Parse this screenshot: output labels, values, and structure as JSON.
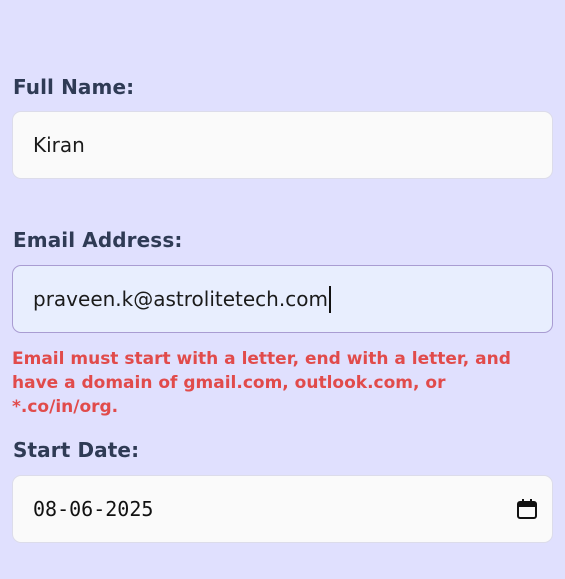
{
  "form": {
    "full_name": {
      "label": "Full Name:",
      "value": "Kiran"
    },
    "email": {
      "label": "Email Address:",
      "value": "praveen.k@astrolitetech.com",
      "error": "Email must start with a letter, end with a letter, and have a domain of gmail.com, outlook.com, or *.co/in/org."
    },
    "start_date": {
      "label": "Start Date:",
      "value": "08-06-2025",
      "icon": "calendar-icon"
    }
  },
  "colors": {
    "background": "#e0e0fe",
    "label": "#2f3b55",
    "error": "#e14b4b",
    "focus_border": "#a99cd2",
    "focus_background": "#e8eefe"
  }
}
